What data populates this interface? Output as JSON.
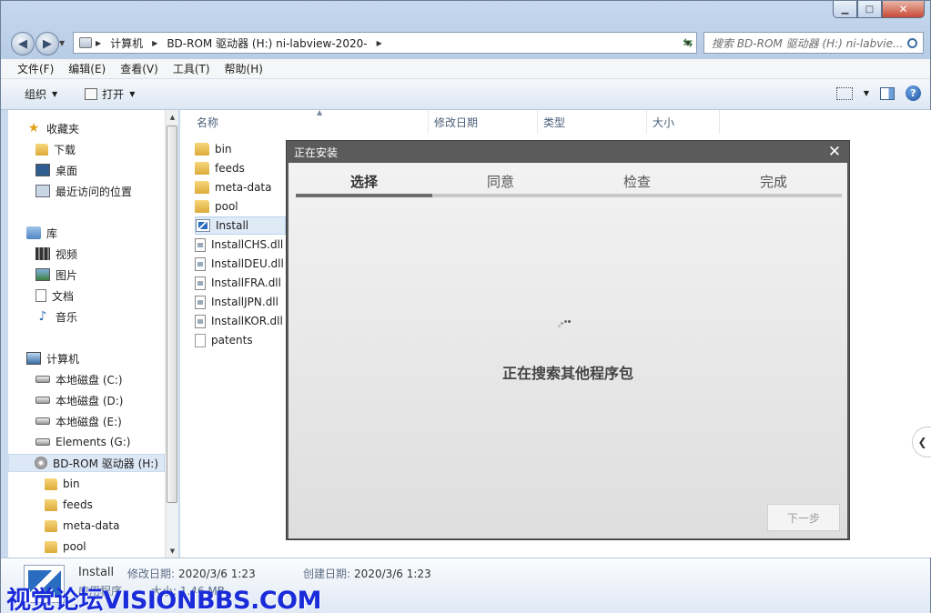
{
  "window": {
    "min_glyph": "▁",
    "max_glyph": "□",
    "close_glyph": "✕"
  },
  "address": {
    "segments": [
      "计算机",
      "BD-ROM 驱动器 (H:) ni-labview-2020-"
    ],
    "search_placeholder": "搜索 BD-ROM 驱动器 (H:) ni-labvie..."
  },
  "menu": [
    "文件(F)",
    "编辑(E)",
    "查看(V)",
    "工具(T)",
    "帮助(H)"
  ],
  "toolbar": {
    "organize": "组织",
    "open": "打开"
  },
  "nav": {
    "favorites": "收藏夹",
    "downloads": "下载",
    "desktop": "桌面",
    "recent": "最近访问的位置",
    "libraries": "库",
    "videos": "视频",
    "pictures": "图片",
    "documents": "文档",
    "music": "音乐",
    "computer": "计算机",
    "drive_c": "本地磁盘 (C:)",
    "drive_d": "本地磁盘 (D:)",
    "drive_e": "本地磁盘 (E:)",
    "drive_g": "Elements (G:)",
    "drive_h": "BD-ROM 驱动器 (H:)",
    "sub": [
      "bin",
      "feeds",
      "meta-data",
      "pool"
    ]
  },
  "columns": {
    "name": "名称",
    "modified": "修改日期",
    "type": "类型",
    "size": "大小"
  },
  "files": [
    "bin",
    "feeds",
    "meta-data",
    "pool",
    "Install",
    "InstallCHS.dll",
    "InstallDEU.dll",
    "InstallFRA.dll",
    "InstallJPN.dll",
    "InstallKOR.dll",
    "patents"
  ],
  "dialog": {
    "title": "正在安装",
    "steps": [
      "选择",
      "同意",
      "检查",
      "完成"
    ],
    "active_step": 0,
    "status": "正在搜索其他程序包",
    "next": "下一步"
  },
  "details": {
    "name": "Install",
    "modified_label": "修改日期:",
    "modified": "2020/3/6 1:23",
    "created_label": "创建日期:",
    "created": "2020/3/6 1:23",
    "type_partial": "应用程序",
    "size_partial": "大小: 1.46 MB"
  },
  "watermark": "视觉论坛VISIONBBS.COM"
}
